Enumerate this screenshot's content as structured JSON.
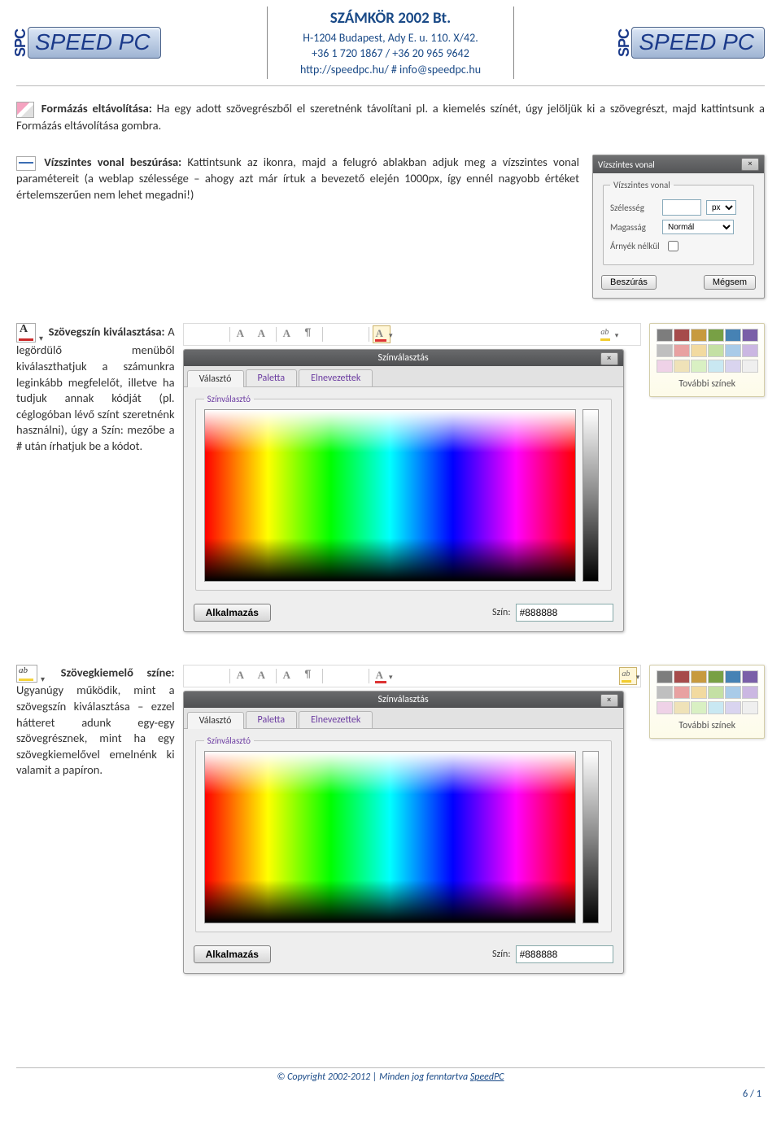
{
  "header": {
    "brand_prefix": "SPC",
    "brand_name": "SPEED PC",
    "company_name": "SZÁMKÖR 2002 Bt.",
    "address": "H-1204 Budapest, Ady E. u. 110. X/42.",
    "phones": "+36 1 720 1867 / +36 20 965 9642",
    "link_line": "http://speedpc.hu/ # info@speedpc.hu"
  },
  "section_eraser": {
    "title": "Formázás eltávolítása:",
    "text": "Ha egy adott szövegrészből el szeretnénk távolítani pl. a kiemelés színét, úgy jelöljük ki a szövegrészt, majd kattintsunk a Formázás eltávolítása gombra."
  },
  "section_hr": {
    "title": "Vízszintes vonal beszúrása:",
    "text": "Kattintsunk az ikonra, majd a felugró ablakban adjuk meg a vízszintes vonal paramétereit (a weblap szélessége – ahogy azt már írtuk a bevezető elején 1000px, így ennél nagyobb értéket értelemszerűen nem lehet megadni!)"
  },
  "hr_dialog": {
    "title": "Vízszintes vonal",
    "legend": "Vízszintes vonal",
    "width_label": "Szélesség",
    "width_unit": "px",
    "height_label": "Magasság",
    "height_value": "Normál",
    "shadow_label": "Árnyék nélkül",
    "insert": "Beszúrás",
    "cancel": "Mégsem"
  },
  "section_textcolor": {
    "title": "Szövegszín kiválasztása:",
    "text": "A legördülő menüből kiválaszthatjuk a számunkra leginkább megfelelőt, illetve ha tudjuk annak kódját (pl. céglogóban lévő színt szeretnénk használni), úgy a Szín: mezőbe a # után írhatjuk be a kódot."
  },
  "section_highlight": {
    "title": "Szövegkiemelő színe:",
    "text": "Ugyanúgy működik, mint a szövegszín kiválasztása – ezzel hátteret adunk egy-egy szövegrésznek, mint ha egy szövegkiemelővel emelnénk ki valamit a papíron."
  },
  "color_dialog": {
    "title": "Színválasztás",
    "tabs": [
      "Választó",
      "Paletta",
      "Elnevezettek"
    ],
    "legend": "Színválasztó",
    "apply": "Alkalmazás",
    "szin_label": "Szín:",
    "szin_value": "#888888"
  },
  "swatches": {
    "more_colors": "További színek",
    "row1": [
      "#7d7d7d",
      "#a64b4b",
      "#c79a3f",
      "#78a045",
      "#4682b4",
      "#7a5fa8"
    ],
    "row2": [
      "#bfbfbf",
      "#e8a1a1",
      "#f2daa0",
      "#c4e0a4",
      "#a9cbe8",
      "#cbb7e2"
    ],
    "row3": [
      "#efd2e7",
      "#efe2b8",
      "#d9f0c3",
      "#c9e8f2",
      "#d9d4ef",
      "#efefef"
    ]
  },
  "footer": {
    "copy": "© Copyright 2002-2012 | Minden jog fenntartva ",
    "brand": "SpeedPC",
    "pagenum": "6 / 1"
  }
}
